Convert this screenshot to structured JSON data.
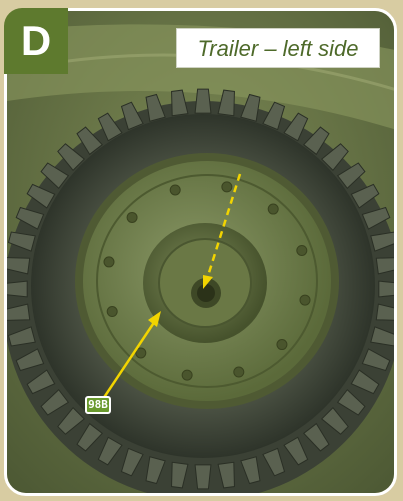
{
  "section_badge": "D",
  "caption": "Trailer – left side",
  "callouts": [
    {
      "label": "98B"
    }
  ],
  "illustration": {
    "subject": "wheel-tire-photo",
    "colors": {
      "tire": "#3f4538",
      "rim": "#6d7b4a",
      "hub": "#56623a",
      "leader_line": "#f2d400",
      "badge": "#5e7a2e"
    }
  }
}
